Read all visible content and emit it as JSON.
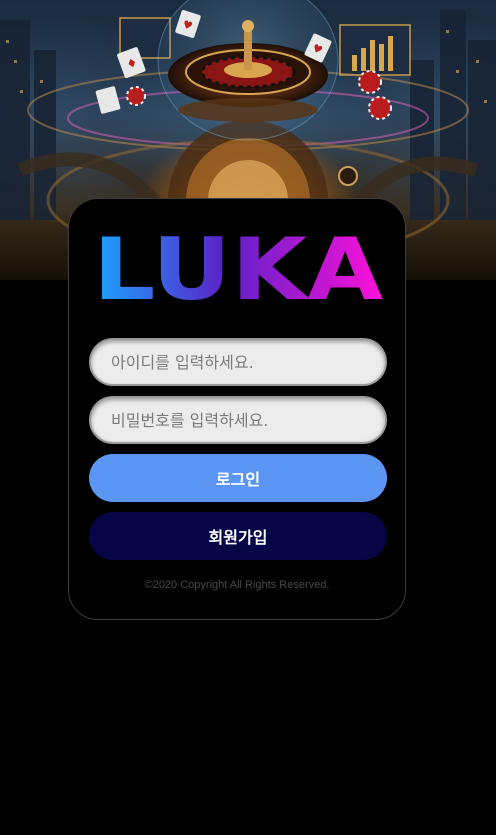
{
  "brand": {
    "logo_text": "LUKA",
    "gradient_start": "#1aa6ff",
    "gradient_mid": "#5a22c8",
    "gradient_end": "#ff10d8"
  },
  "hero": {
    "image": "casino-roulette-illustration"
  },
  "login": {
    "id_placeholder": "아이디를 입력하세요.",
    "password_placeholder": "비밀번호를 입력하세요.",
    "login_label": "로그인",
    "join_label": "회원가입",
    "login_color": "#5b96f5",
    "join_color": "#060545"
  },
  "footer": {
    "copyright": "©2020 Copyright All Rights Reserved."
  }
}
